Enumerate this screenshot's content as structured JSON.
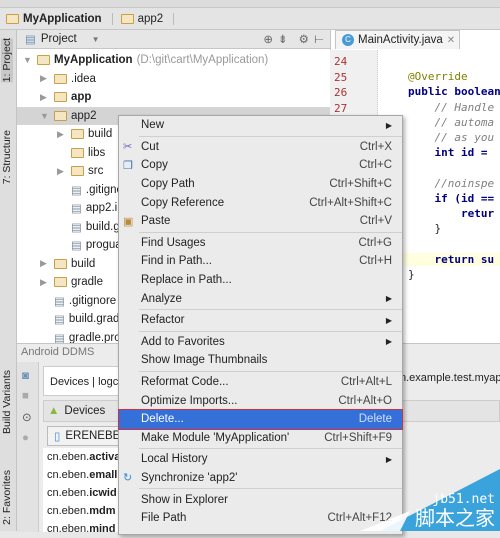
{
  "breadcrumb": [
    "MyApplication",
    "app2"
  ],
  "left_strip": {
    "project": "1: Project",
    "structure": "7: Structure",
    "build_variants": "Build Variants",
    "favorites": "2: Favorites"
  },
  "project_panel": {
    "view": "Project",
    "tree": [
      {
        "label": "MyApplication",
        "hint": "(D:\\git\\cart\\MyApplication)",
        "bold": true,
        "depth": 0,
        "expanded": true
      },
      {
        "label": ".idea",
        "depth": 1,
        "collapsed": true
      },
      {
        "label": "app",
        "bold": true,
        "depth": 1,
        "collapsed": true
      },
      {
        "label": "app2",
        "depth": 1,
        "expanded": true,
        "selected": true
      },
      {
        "label": "build",
        "depth": 2,
        "collapsed": true
      },
      {
        "label": "libs",
        "depth": 2
      },
      {
        "label": "src",
        "depth": 2,
        "collapsed": true
      },
      {
        "label": ".gitignore",
        "depth": 2,
        "file": true
      },
      {
        "label": "app2.iml",
        "depth": 2,
        "file": true
      },
      {
        "label": "build.gradle",
        "depth": 2,
        "file": true
      },
      {
        "label": "proguard-rules.pro",
        "depth": 2,
        "file": true
      },
      {
        "label": "build",
        "depth": 1,
        "collapsed": true
      },
      {
        "label": "gradle",
        "depth": 1,
        "collapsed": true
      },
      {
        "label": ".gitignore",
        "depth": 1,
        "file": true
      },
      {
        "label": "build.gradle",
        "depth": 1,
        "file": true
      },
      {
        "label": "gradle.properties",
        "depth": 1,
        "file": true
      }
    ]
  },
  "editor": {
    "tab": "MainActivity.java",
    "line_numbers": [
      "24",
      "25",
      "26",
      "27"
    ],
    "code": [
      "",
      "@Override",
      "public boolean",
      "    // Handle",
      "    // automa",
      "    // as you",
      "    int id = ",
      "",
      "    //noinspe",
      "    if (id ==",
      "        retur",
      "    }",
      "",
      "    return su",
      "}"
    ]
  },
  "ddms": {
    "title": "Android DDMS",
    "tabs": "Devices | logcat",
    "devices_label": "Devices",
    "device": "ERENEBEN",
    "process_field": "n.example.test.myap",
    "processes": [
      [
        "cn.eben.",
        "activa"
      ],
      [
        "cn.eben.",
        "emall"
      ],
      [
        "cn.eben.",
        "icwid"
      ],
      [
        "cn.eben.",
        "mdm"
      ],
      [
        "cn.eben.",
        "mind"
      ]
    ]
  },
  "context_menu": {
    "groups": [
      [
        {
          "label": "New",
          "submenu": true
        }
      ],
      [
        {
          "label": "Cut",
          "shortcut": "Ctrl+X",
          "icon": "scissors"
        },
        {
          "label": "Copy",
          "shortcut": "Ctrl+C",
          "icon": "copy"
        },
        {
          "label": "Copy Path",
          "shortcut": "Ctrl+Shift+C"
        },
        {
          "label": "Copy Reference",
          "shortcut": "Ctrl+Alt+Shift+C"
        },
        {
          "label": "Paste",
          "shortcut": "Ctrl+V",
          "icon": "paste"
        }
      ],
      [
        {
          "label": "Find Usages",
          "shortcut": "Ctrl+G"
        },
        {
          "label": "Find in Path...",
          "shortcut": "Ctrl+H"
        },
        {
          "label": "Replace in Path..."
        },
        {
          "label": "Analyze",
          "submenu": true
        }
      ],
      [
        {
          "label": "Refactor",
          "submenu": true
        }
      ],
      [
        {
          "label": "Add to Favorites",
          "submenu": true
        },
        {
          "label": "Show Image Thumbnails"
        }
      ],
      [
        {
          "label": "Reformat Code...",
          "shortcut": "Ctrl+Alt+L"
        },
        {
          "label": "Optimize Imports...",
          "shortcut": "Ctrl+Alt+O"
        },
        {
          "label": "Delete...",
          "shortcut": "Delete",
          "selected": true
        },
        {
          "label": "Make Module 'MyApplication'",
          "shortcut": "Ctrl+Shift+F9"
        }
      ],
      [
        {
          "label": "Local History",
          "submenu": true
        },
        {
          "label": "Synchronize 'app2'",
          "icon": "sync"
        }
      ],
      [
        {
          "label": "Show in Explorer"
        },
        {
          "label": "File Path",
          "shortcut": "Ctrl+Alt+F12"
        }
      ]
    ]
  },
  "watermark": {
    "site": "jb51.net",
    "name": "脚本之家"
  },
  "colors": {
    "selection": "#3470d8",
    "folder": "#c9a04a"
  }
}
